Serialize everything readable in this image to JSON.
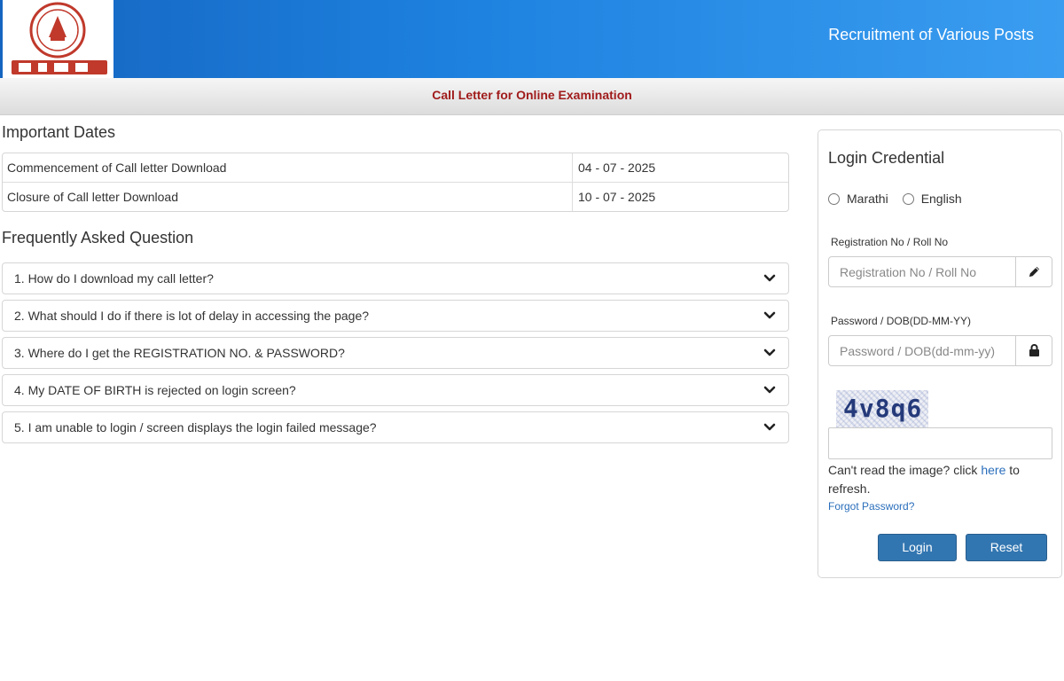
{
  "header": {
    "logo_alt": "MIDC",
    "title": "Recruitment of Various Posts"
  },
  "subheader": {
    "title": "Call Letter for Online Examination"
  },
  "important_dates": {
    "title": "Important Dates",
    "rows": [
      {
        "label": "Commencement of Call letter Download",
        "value": "04 - 07 - 2025"
      },
      {
        "label": "Closure of Call letter Download",
        "value": "10 - 07 - 2025"
      }
    ]
  },
  "faq": {
    "title": "Frequently Asked Question",
    "items": [
      "1. How do I download my call letter?",
      "2. What should I do if there is lot of delay in accessing the page?",
      "3. Where do I get the REGISTRATION NO. & PASSWORD?",
      "4. My DATE OF BIRTH is rejected on login screen?",
      "5. I am unable to login / screen displays the login failed message?"
    ]
  },
  "login": {
    "title": "Login Credential",
    "languages": [
      "Marathi",
      "English"
    ],
    "registration_label": "Registration No / Roll No",
    "registration_placeholder": "Registration No / Roll No",
    "registration_icon": "pencil-icon",
    "password_label": "Password / DOB(DD-MM-YY)",
    "password_placeholder": "Password / DOB(dd-mm-yy)",
    "password_icon": "lock-icon",
    "captcha_text": "4v8q6",
    "refresh_prefix": "Can't read the image? click ",
    "refresh_link": "here",
    "refresh_suffix": " to refresh.",
    "forgot_password": "Forgot Password?",
    "login_button": "Login",
    "reset_button": "Reset"
  },
  "colors": {
    "header_blue": "#1e82e0",
    "subheader_title": "#a01b1b",
    "button_blue": "#3276b1",
    "link_blue": "#2a6ebb"
  }
}
